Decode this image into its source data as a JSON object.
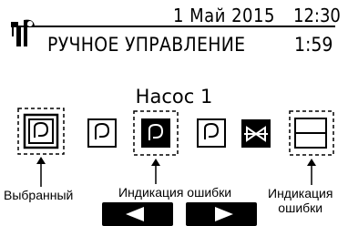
{
  "header": {
    "date": "1 Май 2015",
    "time": "12:30",
    "title": "РУЧНОЕ УПРАВЛЕНИЕ",
    "timer": "1:59",
    "icon": "wrench-screwdriver-icon"
  },
  "main": {
    "pump_title": "Насос 1",
    "components": [
      {
        "icon": "pump-icon",
        "state": "selected"
      },
      {
        "icon": "pump-icon",
        "state": "normal"
      },
      {
        "icon": "pump-icon",
        "state": "fault"
      },
      {
        "icon": "pump-icon",
        "state": "normal"
      },
      {
        "icon": "valve-icon",
        "state": "inverted"
      },
      {
        "icon": "heater-icon",
        "state": "fault"
      }
    ]
  },
  "captions": {
    "selected": "Выбранный",
    "fault_indication": "Индикация ошибки",
    "fault_indication_right_line1": "Индикация",
    "fault_indication_right_line2": "ошибки"
  },
  "navigation": {
    "left_icon": "left-arrow-icon",
    "right_icon": "right-arrow-icon"
  },
  "colors": {
    "foreground": "#000000",
    "background": "#ffffff"
  }
}
